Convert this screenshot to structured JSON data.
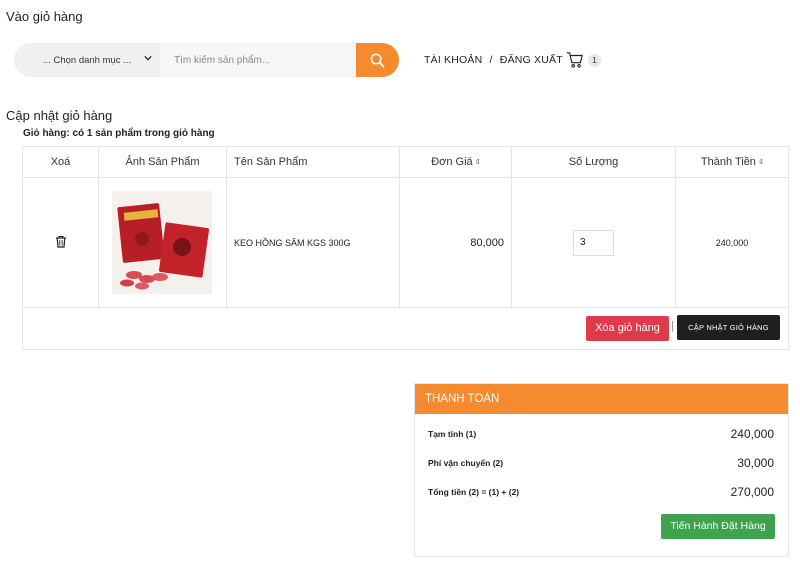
{
  "header": {
    "page_title": "Vào giỏ hàng",
    "category_select": "... Chọn danh mục ...",
    "search_placeholder": "Tìm kiếm sản phẩm...",
    "account_label": "TÀI KHOẢN",
    "account_separator": "/",
    "logout_label": "ĐĂNG XUẤT",
    "cart_count": "1"
  },
  "cart": {
    "section_title": "Cập nhật giỏ hàng",
    "summary": "Giỏ hàng: có 1 sản phẩm trong giỏ hàng",
    "columns": {
      "delete": "Xoá",
      "image": "Ảnh Sản Phẩm",
      "name": "Tên Sản Phẩm",
      "price": "Đơn Giá",
      "quantity": "Số Lượng",
      "total": "Thành Tiền"
    },
    "currency_mark": "₫",
    "items": [
      {
        "name": "KEO HỒNG SÂM KGS 300G",
        "price": "80,000",
        "quantity": "3",
        "total": "240,000"
      }
    ],
    "clear_button": "Xóa giỏ hàng",
    "button_separator": "|",
    "update_button": "CẬP NHẬT GIỎ HÀNG"
  },
  "payment": {
    "title": "THANH TOÁN",
    "rows": [
      {
        "label": "Tạm tính (1)",
        "value": "240,000"
      },
      {
        "label": "Phí vận chuyển (2)",
        "value": "30,000"
      },
      {
        "label": "Tổng tiền (2) = (1) + (2)",
        "value": "270,000"
      }
    ],
    "checkout_button": "Tiến Hành Đặt Hàng"
  },
  "colors": {
    "accent": "#f68a2e",
    "danger": "#e03a4a",
    "success": "#3fa34d",
    "dark": "#1f1f1f"
  },
  "icons": {
    "search": "search-icon",
    "cart": "cart-icon",
    "delete": "trash-icon",
    "dropdown": "chevron-down-icon"
  }
}
